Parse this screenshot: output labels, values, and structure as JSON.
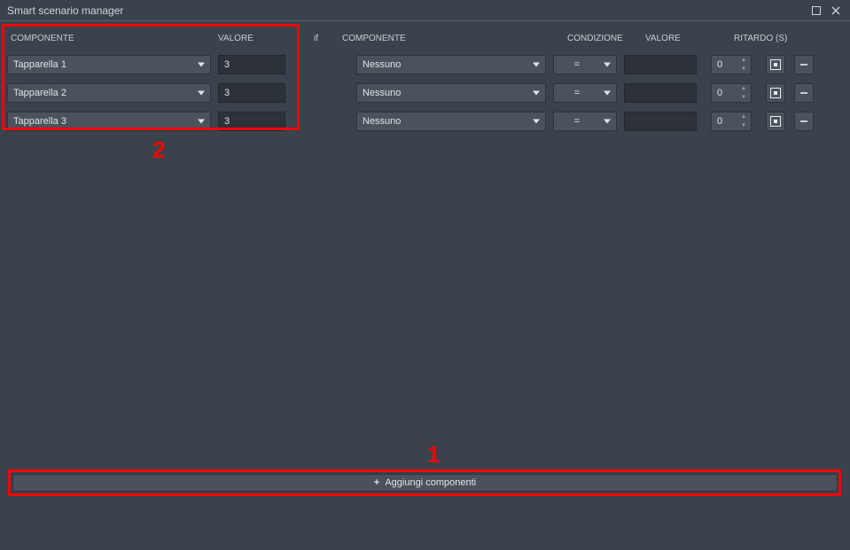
{
  "window": {
    "title": "Smart scenario manager"
  },
  "headers": {
    "left_componente": "COMPONENTE",
    "left_valore": "VALORE",
    "if_label": "if",
    "right_componente": "COMPONENTE",
    "right_condizione": "CONDIZIONE",
    "right_valore": "VALORE",
    "right_ritardo": "Ritardo (s)"
  },
  "rows": [
    {
      "left_component": "Tapparella 1",
      "left_value": "3",
      "right_component": "Nessuno",
      "condition": "=",
      "right_value": "",
      "delay": "0"
    },
    {
      "left_component": "Tapparella 2",
      "left_value": "3",
      "right_component": "Nessuno",
      "condition": "=",
      "right_value": "",
      "delay": "0"
    },
    {
      "left_component": "Tapparella 3",
      "left_value": "3",
      "right_component": "Nessuno",
      "condition": "=",
      "right_value": "",
      "delay": "0"
    }
  ],
  "footer": {
    "add_button": "Aggiungi componenti"
  },
  "annotations": {
    "label1": "1",
    "label2": "2"
  }
}
